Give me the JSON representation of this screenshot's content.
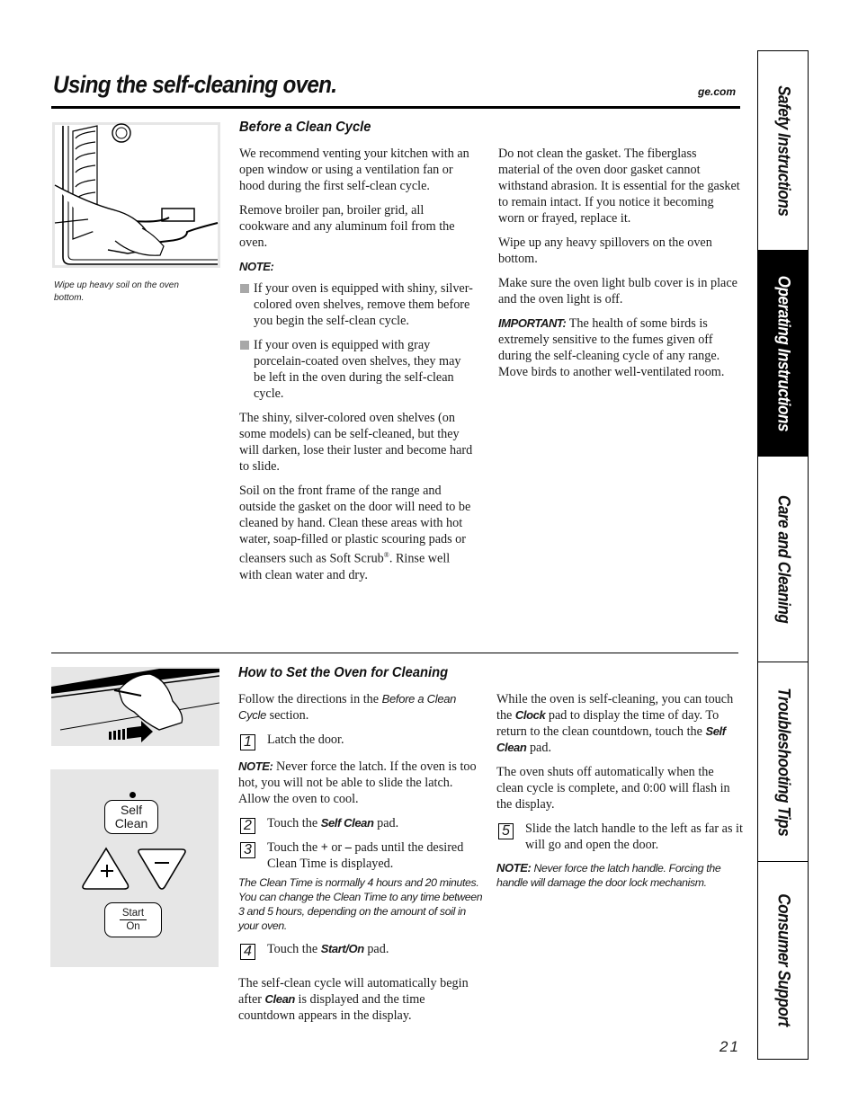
{
  "header": {
    "title": "Using the self-cleaning oven.",
    "site": "ge.com"
  },
  "side_tabs": [
    {
      "label": "Safety Instructions",
      "active": false
    },
    {
      "label": "Operating Instructions",
      "active": true
    },
    {
      "label": "Care and Cleaning",
      "active": false
    },
    {
      "label": "Troubleshooting Tips",
      "active": false
    },
    {
      "label": "Consumer Support",
      "active": false
    }
  ],
  "before": {
    "figure_caption": "Wipe up heavy soil on the oven bottom.",
    "heading": "Before a Clean Cycle",
    "left": {
      "p1": "We recommend venting your kitchen with an open window or using a ventilation fan or hood during the first self-clean cycle.",
      "p2": "Remove broiler pan, broiler grid, all cookware and any aluminum foil from the oven.",
      "note_label": "NOTE:",
      "bullets": [
        "If your oven is equipped with shiny, silver-colored oven shelves, remove them before you begin the self-clean cycle.",
        "If your oven is equipped with gray porcelain-coated oven shelves, they may be left in the oven during the self-clean cycle."
      ],
      "p3": "The shiny, silver-colored oven shelves (on some models) can be self-cleaned, but they will darken, lose their luster and become hard to slide.",
      "p4_a": "Soil on the front frame of the range and outside the gasket on the door will need to be cleaned by hand. Clean these areas with hot water, soap-filled or plastic scouring pads or cleansers such as Soft Scrub",
      "p4_reg": "®",
      "p4_b": ". Rinse well with clean water and dry."
    },
    "right": {
      "p1": "Do not clean the gasket. The fiberglass material of the oven door gasket cannot withstand abrasion. It is essential for the gasket to remain intact. If you notice it becoming worn or frayed, replace it.",
      "p2": "Wipe up any heavy spillovers on the oven bottom.",
      "p3": "Make sure the oven light bulb cover is in place and the oven light is off.",
      "important_label": "IMPORTANT:",
      "important_text": " The health of some birds is extremely sensitive to the fumes given off during the self-cleaning cycle of any range. Move birds to another well-ventilated room."
    }
  },
  "how": {
    "heading": "How to Set the Oven for Cleaning",
    "control_panel": {
      "self_clean_top": "Self",
      "self_clean_bottom": "Clean",
      "plus": "+",
      "minus": "−",
      "start_top": "Start",
      "start_bottom": "On"
    },
    "left": {
      "intro_a": "Follow the directions in the ",
      "intro_ref": "Before a Clean Cycle",
      "intro_b": " section.",
      "step1_num": "1",
      "step1": "Latch the door.",
      "note_label": "NOTE:",
      "note_text": " Never force the latch. If the oven is too hot, you will not be able to slide the latch. Allow the oven to cool.",
      "step2_num": "2",
      "step2_a": "Touch the ",
      "step2_pad": "Self Clean",
      "step2_b": " pad.",
      "step3_num": "3",
      "step3_a": "Touch the ",
      "step3_plus": "+",
      "step3_b": " or ",
      "step3_minus": "–",
      "step3_c": " pads until the desired Clean Time is displayed.",
      "clean_time_note": "The Clean Time is normally 4 hours and 20 minutes. You can change the Clean Time to any time between 3 and 5 hours, depending on the amount of soil in your oven.",
      "step4_num": "4",
      "step4_a": "Touch the ",
      "step4_pad": "Start/On",
      "step4_b": " pad.",
      "outro_a": "The self-clean cycle will automatically begin after ",
      "outro_word": "Clean",
      "outro_b": " is displayed and the time countdown appears in the display."
    },
    "right": {
      "p1_a": "While the oven is self-cleaning, you can touch the ",
      "p1_clock": "Clock",
      "p1_b": " pad to display the time of day. To return to the clean countdown, touch the ",
      "p1_selfclean": "Self Clean",
      "p1_c": " pad.",
      "p2": "The oven shuts off automatically when the clean cycle is complete, and 0:00 will flash in the display.",
      "step5_num": "5",
      "step5": "Slide the latch handle to the left as far as it will go and open the door.",
      "note_label": "NOTE:",
      "note_text": " Never force the latch handle. Forcing the handle will damage the door lock mechanism."
    }
  },
  "footer": {
    "page_number": "21"
  }
}
